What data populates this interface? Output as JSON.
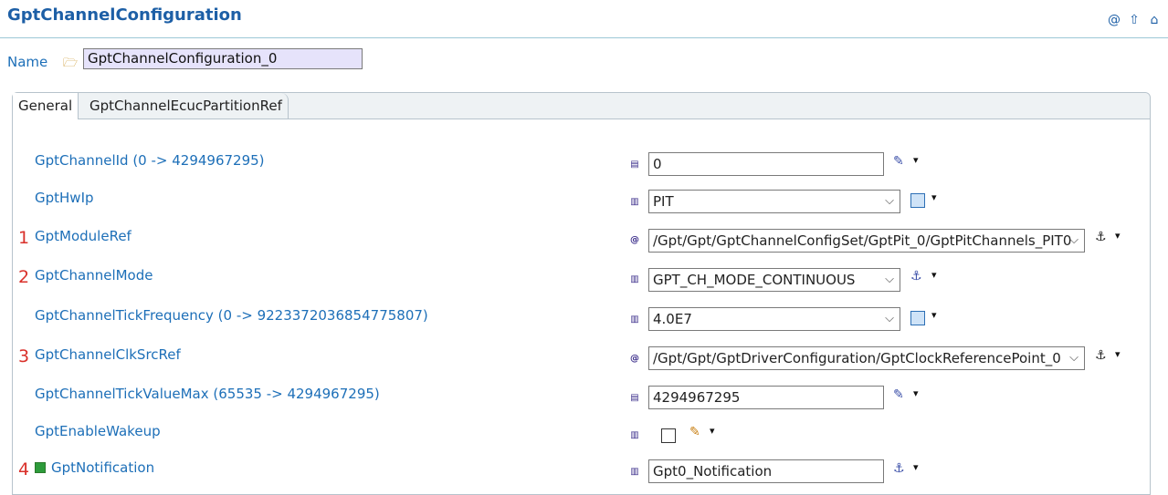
{
  "header": {
    "title": "GptChannelConfiguration",
    "icons": [
      "at-icon",
      "up-arrow-icon",
      "home-icon"
    ]
  },
  "name": {
    "label": "Name",
    "value": "GptChannelConfiguration_0"
  },
  "tabs": [
    {
      "label": "General",
      "active": true
    },
    {
      "label": "GptChannelEcucPartitionRef",
      "active": false
    }
  ],
  "params": [
    {
      "label": "GptChannelId (0 -> 4294967295)",
      "value": "0"
    },
    {
      "label": "GptHwIp",
      "value": "PIT"
    },
    {
      "marker": "1",
      "label": "GptModuleRef",
      "value": "/Gpt/Gpt/GptChannelConfigSet/GptPit_0/GptPitChannels_PIT0"
    },
    {
      "marker": "2",
      "label": "GptChannelMode",
      "value": "GPT_CH_MODE_CONTINUOUS"
    },
    {
      "label": "GptChannelTickFrequency (0 -> 9223372036854775807)",
      "value": "4.0E7"
    },
    {
      "marker": "3",
      "label": "GptChannelClkSrcRef",
      "value": "/Gpt/Gpt/GptDriverConfiguration/GptClockReferencePoint_0"
    },
    {
      "label": "GptChannelTickValueMax (65535 -> 4294967295)",
      "value": "4294967295"
    },
    {
      "label": "GptEnableWakeup",
      "checked": false
    },
    {
      "marker": "4",
      "label": "GptNotification",
      "value": "Gpt0_Notification"
    }
  ],
  "glyphs": {
    "dropdown": "▾",
    "combo_arrow": "⌵",
    "at": "@",
    "up": "⇧",
    "home": "⌂",
    "folder": "🗁",
    "pencil": "✎",
    "link": "⚓"
  }
}
